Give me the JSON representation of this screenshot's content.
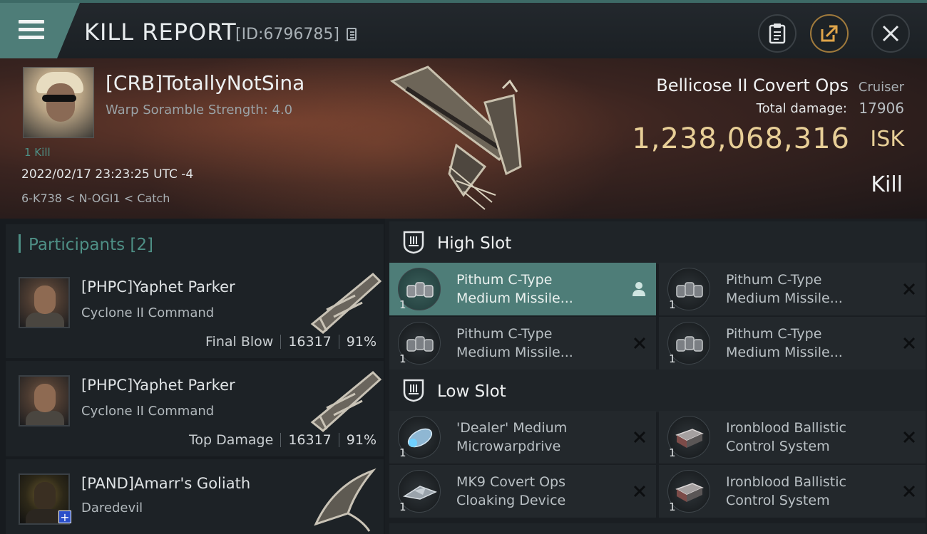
{
  "header": {
    "title": "KILL REPORT",
    "kill_id": "[ID:6796785]",
    "buttons": [
      "menu-button",
      "clipboard-button",
      "share-button",
      "close-button"
    ]
  },
  "victim": {
    "pilot_name": "[CRB]TotallyNotSina",
    "warp_scramble": "Warp Soramble Strength: 4.0",
    "kills": "1 Kill",
    "datetime": "2022/02/17 23:23:25 UTC -4",
    "location": "6-K738 < N-OGI1 < Catch",
    "ship_name": "Bellicose II Covert Ops",
    "ship_class": "Cruiser",
    "damage_label": "Total damage:",
    "damage_value": "17906",
    "isk_value": "1,238,068,316",
    "isk_label": "ISK",
    "report_type": "Kill"
  },
  "participants": {
    "label": "Participants",
    "count": "[2]",
    "rows": [
      {
        "name": "[PHPC]Yaphet Parker",
        "ship": "Cyclone II Command",
        "tag": "Final Blow",
        "damage": "16317",
        "percent": "91%"
      },
      {
        "name": "[PHPC]Yaphet Parker",
        "ship": "Cyclone II Command",
        "tag": "Top Damage",
        "damage": "16317",
        "percent": "91%"
      },
      {
        "name": "[PAND]Amarr's Goliath",
        "ship": "Daredevil",
        "tag": "",
        "damage": "",
        "percent": ""
      }
    ]
  },
  "fitting": {
    "high_slot": {
      "label": "High Slot",
      "modules": [
        {
          "name": "Pithum C-Type\nMedium Missile...",
          "qty": "1",
          "active": true
        },
        {
          "name": "Pithum C-Type\nMedium Missile...",
          "qty": "1",
          "active": false
        },
        {
          "name": "Pithum C-Type\nMedium Missile...",
          "qty": "1",
          "active": false
        },
        {
          "name": "Pithum C-Type\nMedium Missile...",
          "qty": "1",
          "active": false
        }
      ]
    },
    "low_slot": {
      "label": "Low Slot",
      "modules": [
        {
          "name": "'Dealer' Medium\nMicrowarpdrive",
          "qty": "1"
        },
        {
          "name": "Ironblood Ballistic\nControl System",
          "qty": "1"
        },
        {
          "name": "MK9 Covert Ops\nCloaking Device",
          "qty": "1"
        },
        {
          "name": "Ironblood Ballistic\nControl System",
          "qty": "1"
        }
      ]
    }
  },
  "colors": {
    "accent_teal": "#4e8f85",
    "isk_gold": "#e8cf97",
    "active_module": "#4e7d78"
  }
}
